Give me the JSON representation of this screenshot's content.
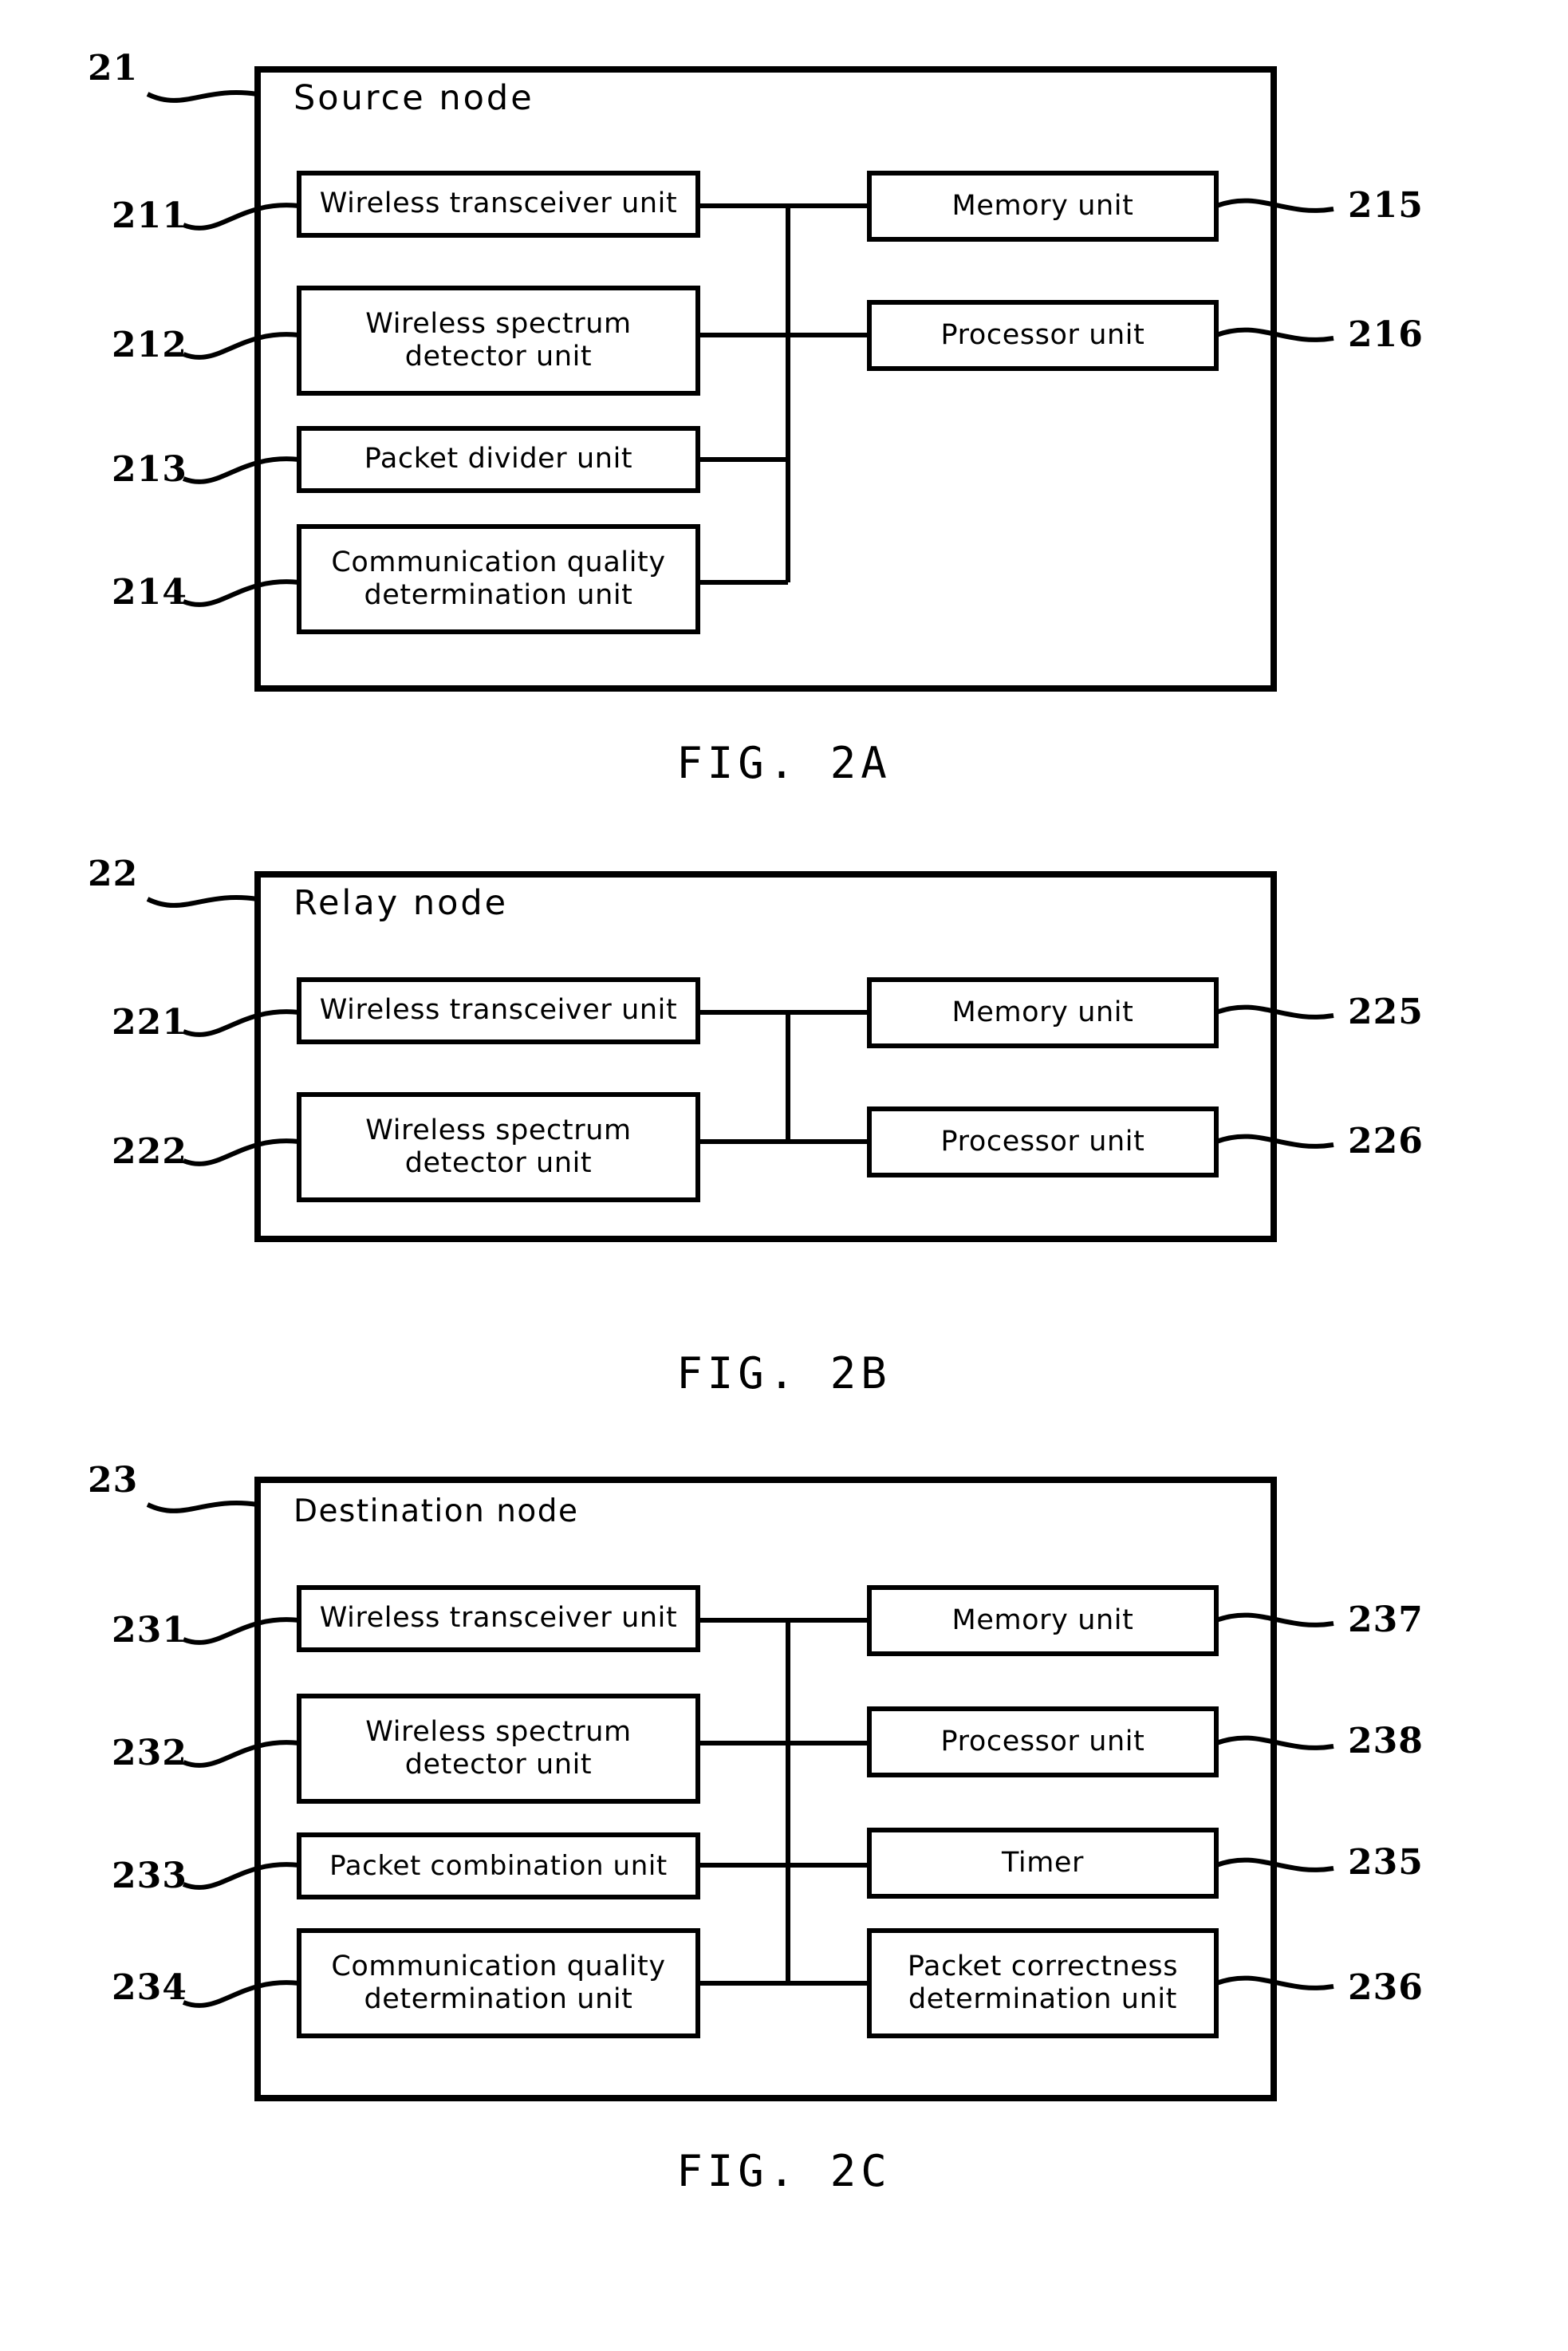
{
  "document": {
    "kind": "patent-figure-sheet",
    "figures": [
      "FIG. 2A",
      "FIG. 2B",
      "FIG. 2C"
    ]
  },
  "fig2a": {
    "caption": "FIG. 2A",
    "node_ref": "21",
    "node_title": "Source node",
    "left_units": [
      {
        "ref": "211",
        "label": "Wireless transceiver unit"
      },
      {
        "ref": "212",
        "label": "Wireless spectrum\ndetector unit"
      },
      {
        "ref": "213",
        "label": "Packet divider unit"
      },
      {
        "ref": "214",
        "label": "Communication quality\ndetermination unit"
      }
    ],
    "right_units": [
      {
        "ref": "215",
        "label": "Memory unit"
      },
      {
        "ref": "216",
        "label": "Processor unit"
      }
    ]
  },
  "fig2b": {
    "caption": "FIG. 2B",
    "node_ref": "22",
    "node_title": "Relay node",
    "left_units": [
      {
        "ref": "221",
        "label": "Wireless transceiver unit"
      },
      {
        "ref": "222",
        "label": "Wireless spectrum\ndetector unit"
      }
    ],
    "right_units": [
      {
        "ref": "225",
        "label": "Memory unit"
      },
      {
        "ref": "226",
        "label": "Processor unit"
      }
    ]
  },
  "fig2c": {
    "caption": "FIG. 2C",
    "node_ref": "23",
    "node_title": "Destination node",
    "left_units": [
      {
        "ref": "231",
        "label": "Wireless transceiver unit"
      },
      {
        "ref": "232",
        "label": "Wireless spectrum\ndetector unit"
      },
      {
        "ref": "233",
        "label": "Packet combination unit"
      },
      {
        "ref": "234",
        "label": "Communication quality\ndetermination unit"
      }
    ],
    "right_units": [
      {
        "ref": "237",
        "label": "Memory unit"
      },
      {
        "ref": "238",
        "label": "Processor unit"
      },
      {
        "ref": "235",
        "label": "Timer"
      },
      {
        "ref": "236",
        "label": "Packet correctness\ndetermination unit"
      }
    ]
  },
  "colors": {
    "ink": "#000000",
    "paper": "#ffffff"
  }
}
